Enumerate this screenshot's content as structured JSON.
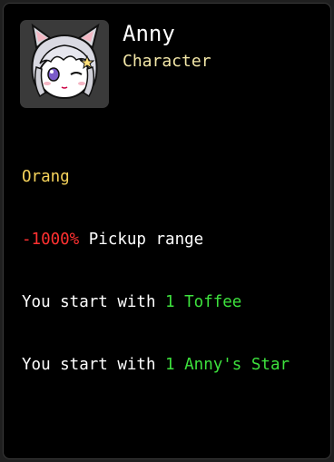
{
  "character": {
    "name": "Anny",
    "type": "Character",
    "portrait_icon": "anny-portrait-icon",
    "faction": "Orang",
    "stats": [
      {
        "value": "-1000%",
        "text": " Pickup range"
      },
      {
        "prefix": "You start with ",
        "value": "1 Toffee"
      },
      {
        "prefix": "You start with ",
        "value": "1 Anny's Star"
      }
    ]
  },
  "colors": {
    "name": "#ffffff",
    "subtitle": "#f3e7a8",
    "faction": "#f6d35b",
    "negative": "#ff3131",
    "positive": "#3de13d",
    "card_background": "#000000",
    "portrait_background": "#3a3a3a"
  }
}
